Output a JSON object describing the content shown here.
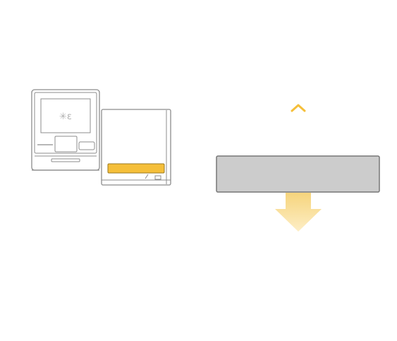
{
  "illustration": {
    "screen_glyph": "✳ε",
    "colors": {
      "accent": "#f5bf3a",
      "accent_light": "#fbe3a8",
      "outline": "#8c8c8c",
      "card_fill": "#cccccc",
      "card_border": "#777777",
      "kiosk_fill": "#ffffff"
    },
    "icons": {
      "up": "chevron-up-icon",
      "down": "arrow-down-icon"
    }
  }
}
